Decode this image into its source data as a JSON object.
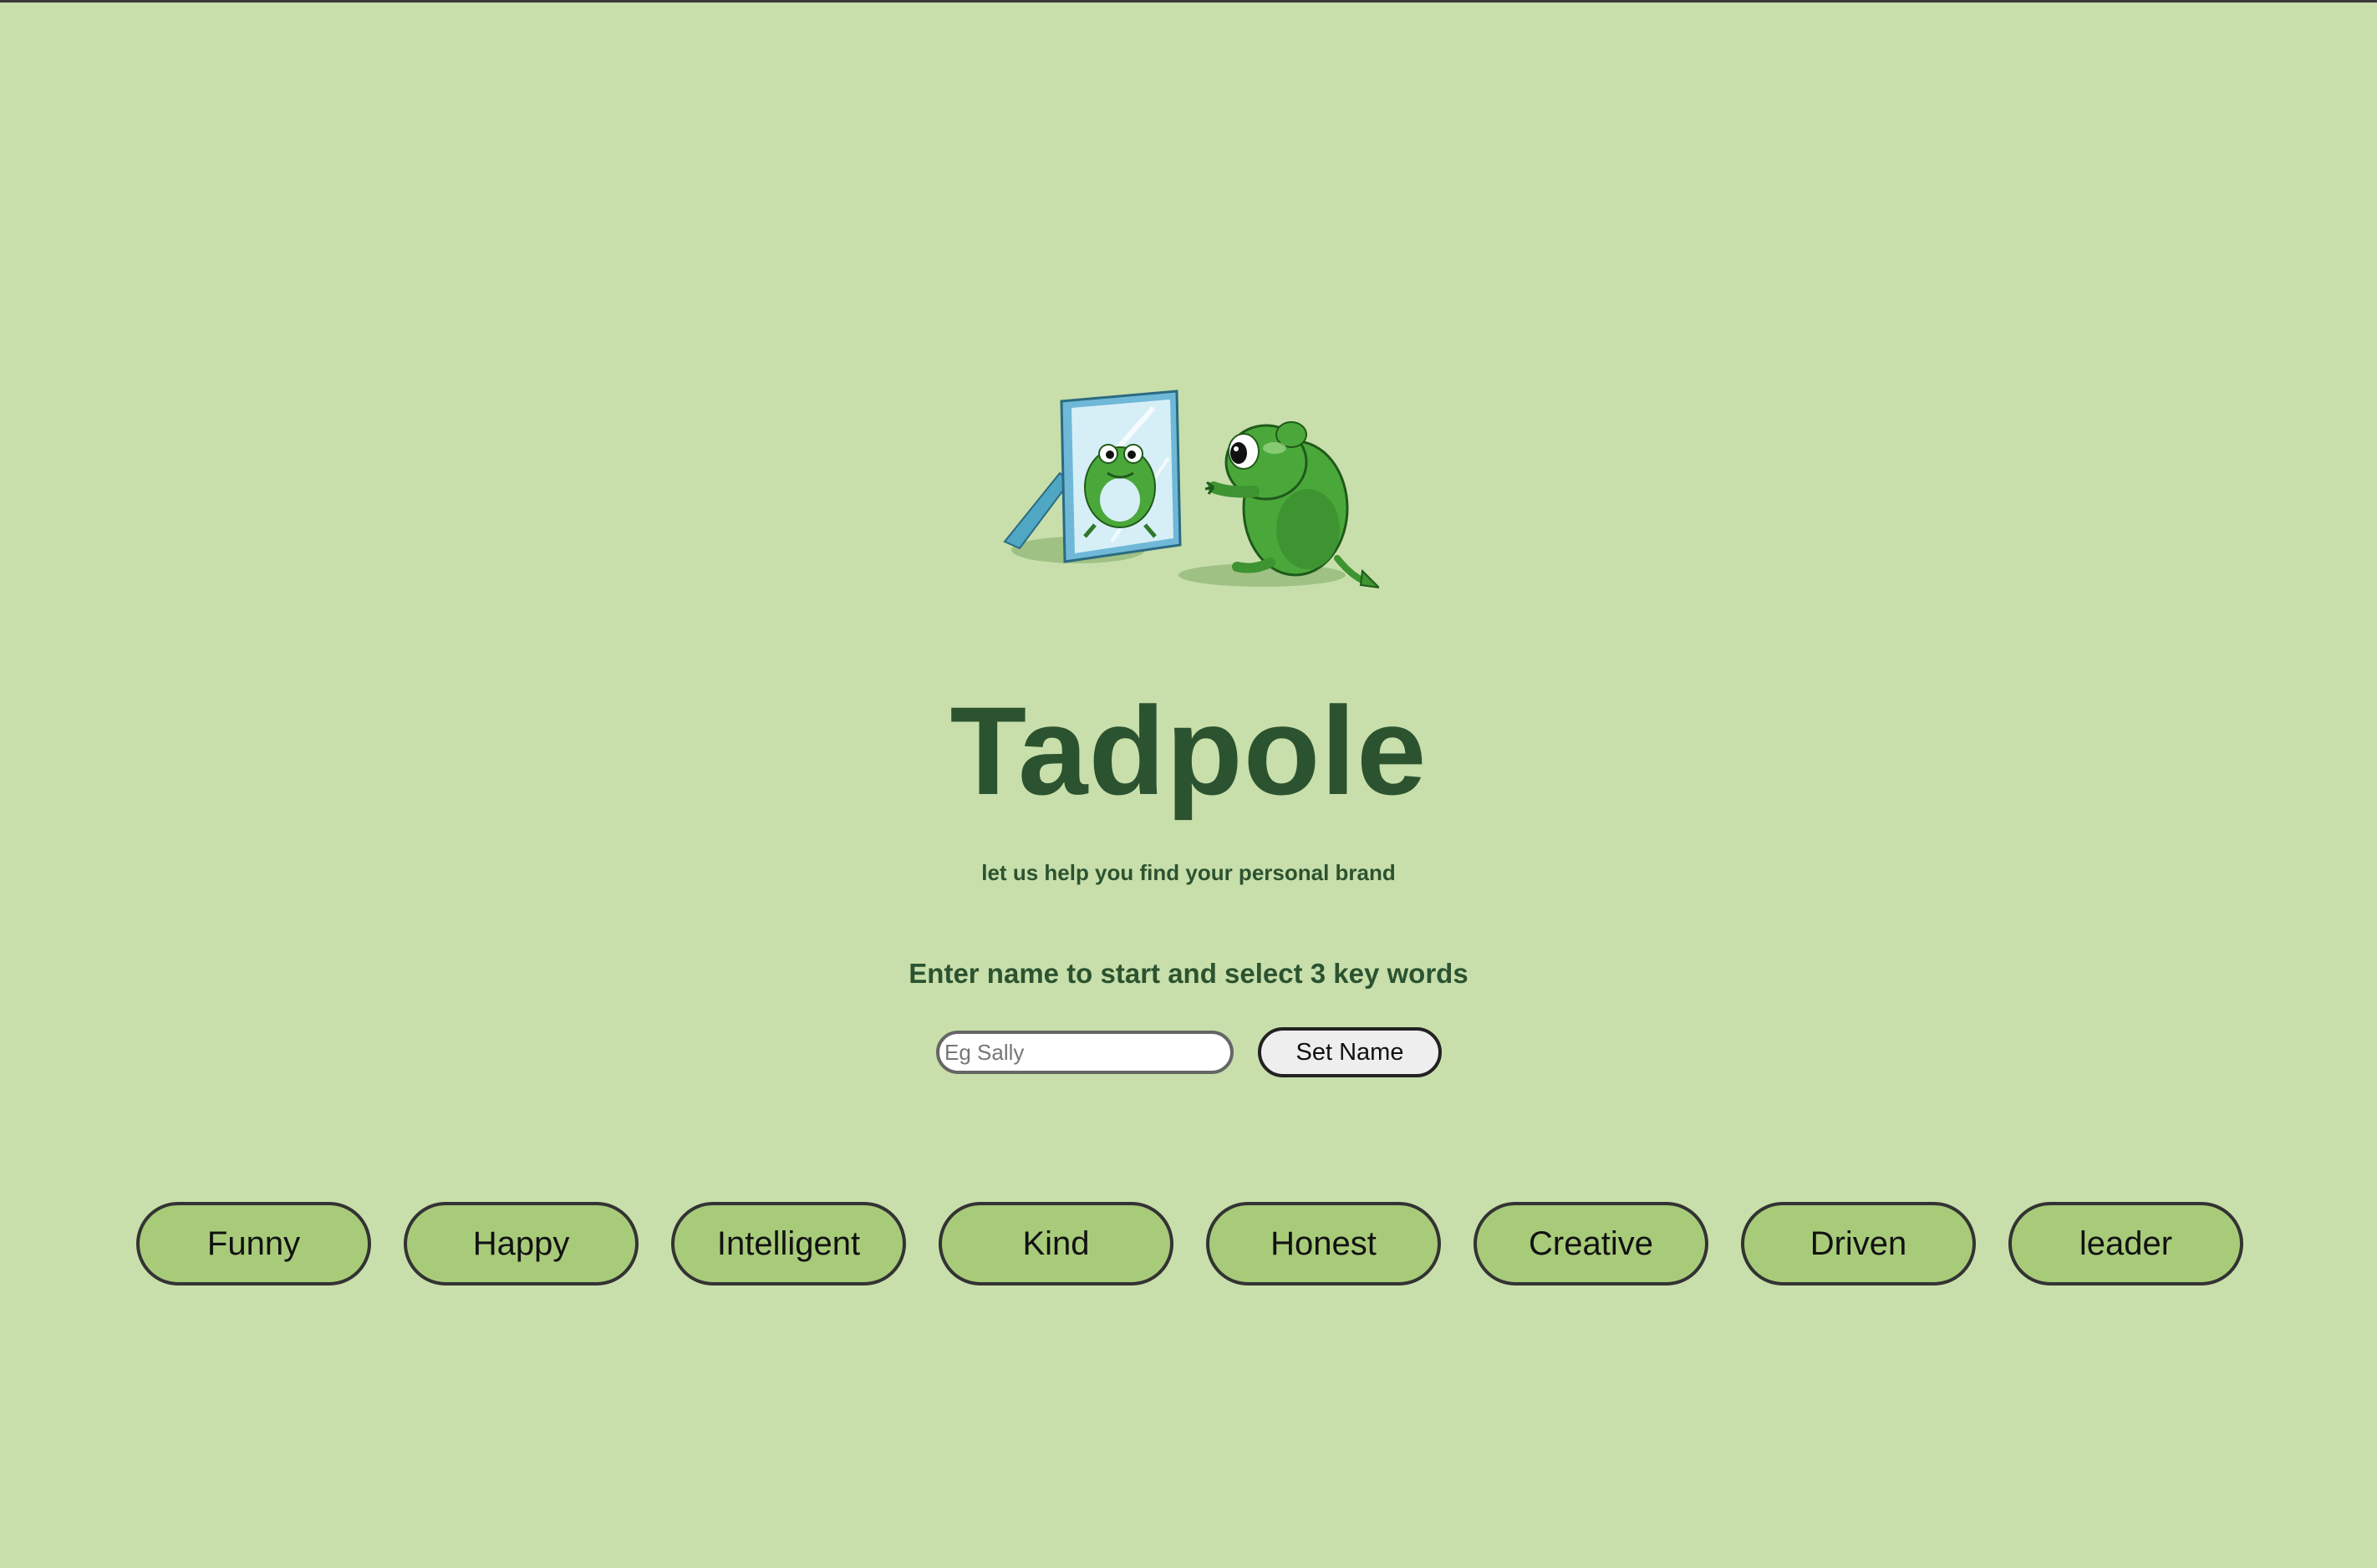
{
  "app": {
    "title": "Tadpole",
    "subtitle": "let us help you find your personal brand",
    "instruction": "Enter name to start and select 3 key words"
  },
  "name_form": {
    "placeholder": "Eg Sally",
    "value": "",
    "button_label": "Set Name"
  },
  "hero_image": {
    "icon": "frog-mirror-illustration"
  },
  "keywords": [
    {
      "label": "Funny"
    },
    {
      "label": "Happy"
    },
    {
      "label": "Intelligent"
    },
    {
      "label": "Kind"
    },
    {
      "label": "Honest"
    },
    {
      "label": "Creative"
    },
    {
      "label": "Driven"
    },
    {
      "label": "leader"
    }
  ],
  "colors": {
    "background": "#c8dfab",
    "heading": "#2c5330",
    "keyword_fill": "#a8cb7a",
    "frog_green": "#4aa83a"
  }
}
